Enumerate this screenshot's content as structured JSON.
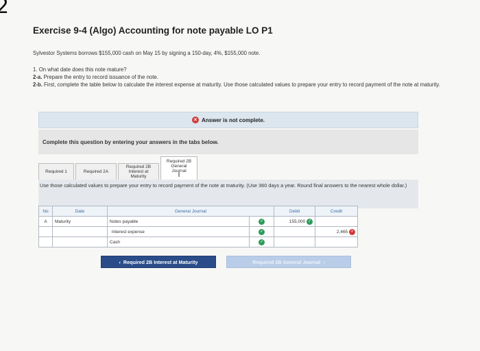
{
  "question_number": "2",
  "title": "Exercise 9-4 (Algo) Accounting for note payable LO P1",
  "problem": "Sylvestor Systems borrows $155,000 cash on May 15 by signing a 150-day, 4%, $155,000 note.",
  "requirements": [
    {
      "num": "1.",
      "text": "On what date does this note mature?"
    },
    {
      "num": "2-a.",
      "text": "Prepare the entry to record issuance of the note."
    },
    {
      "num": "2-b.",
      "text": "First, complete the table below to calculate the interest expense at maturity. Use those calculated values to prepare your entry to record payment of the note at maturity."
    }
  ],
  "banner": {
    "text": "Answer is not complete."
  },
  "instruction": "Complete this question by entering your answers in the tabs below.",
  "tabs": [
    {
      "label": "Required 1"
    },
    {
      "label": "Required 2A"
    },
    {
      "label": "Required 2B Interest at Maturity"
    },
    {
      "label": "Required 2B General Journal"
    }
  ],
  "panel_text": "Use those calculated values to prepare your entry to record payment of the note at maturity. (Use 360 days a year. Round final answers to the nearest whole dollar.)",
  "journal": {
    "headers": {
      "no": "No",
      "date": "Date",
      "account": "General Journal",
      "debit": "Debit",
      "credit": "Credit"
    },
    "rows": [
      {
        "no": "A",
        "date": "Maturity",
        "account": "Notes payable",
        "debit": "155,000",
        "credit": ""
      },
      {
        "no": "",
        "date": "",
        "account": "Interest expense",
        "debit": "",
        "credit": "2,465"
      },
      {
        "no": "",
        "date": "",
        "account": "Cash",
        "debit": "",
        "credit": ""
      }
    ]
  },
  "buttons": {
    "prev": "Required 2B Interest at Maturity",
    "next": "Required 2B General Journal"
  }
}
